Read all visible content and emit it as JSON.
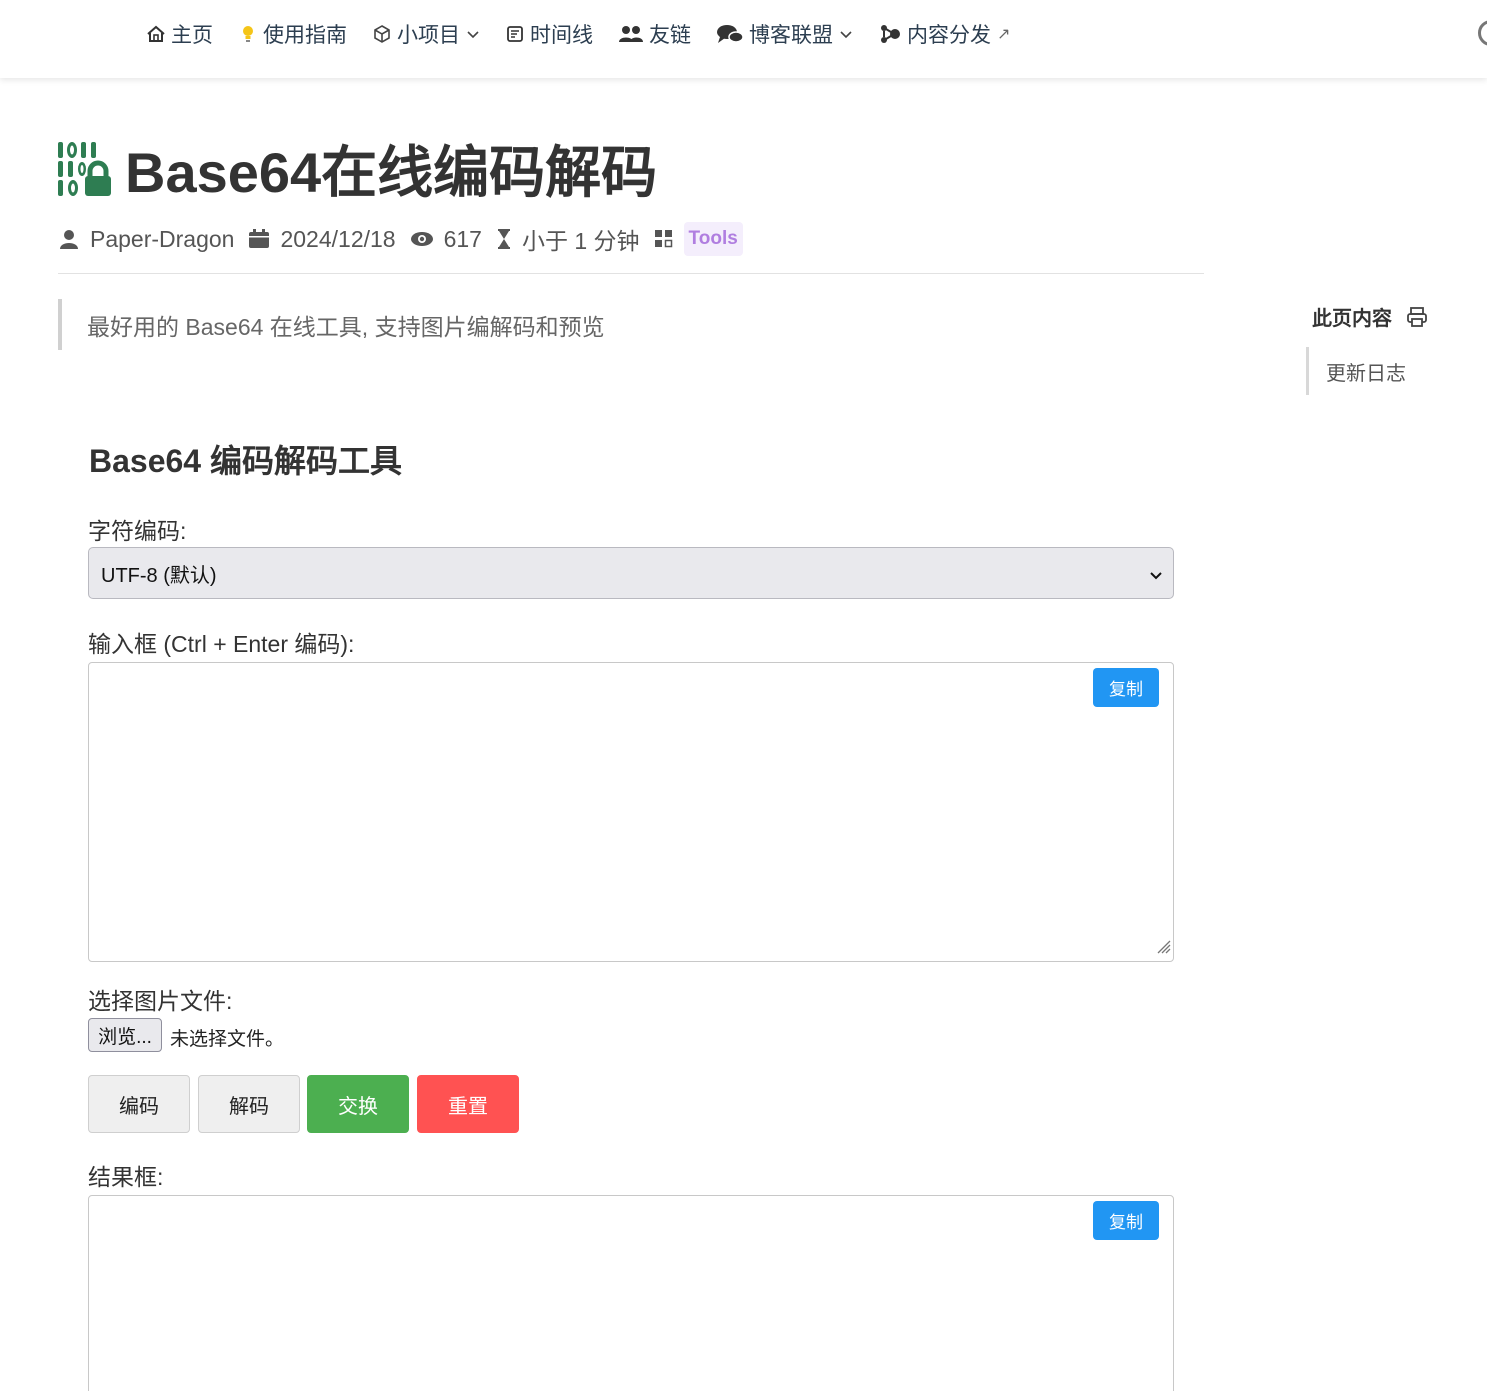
{
  "nav": {
    "items": [
      {
        "label": "主页",
        "icon": "home-icon"
      },
      {
        "label": "使用指南",
        "icon": "lightbulb-icon"
      },
      {
        "label": "小项目",
        "icon": "cube-icon",
        "dropdown": true
      },
      {
        "label": "时间线",
        "icon": "timeline-icon"
      },
      {
        "label": "友链",
        "icon": "users-icon"
      },
      {
        "label": "博客联盟",
        "icon": "chat-icon",
        "dropdown": true
      },
      {
        "label": "内容分发",
        "icon": "share-icon",
        "external": "↗"
      }
    ]
  },
  "page": {
    "title": "Base64在线编码解码",
    "title_icon": "binary-lock-icon",
    "title_icon_color": "#2e7d52"
  },
  "meta": {
    "author": "Paper-Dragon",
    "date": "2024/12/18",
    "views": "617",
    "read_time": "小于 1 分钟",
    "tag": "Tools"
  },
  "description": "最好用的 Base64 在线工具, 支持图片编解码和预览",
  "toc": {
    "heading": "此页内容",
    "items": [
      "更新日志"
    ]
  },
  "tool": {
    "title": "Base64 编码解码工具",
    "charset_label": "字符编码:",
    "charset_value": "UTF-8 (默认)",
    "input_label": "输入框 (Ctrl + Enter 编码):",
    "input_value": "",
    "copy_label": "复制",
    "file_label": "选择图片文件:",
    "file_button": "浏览...",
    "file_status": "未选择文件。",
    "buttons": {
      "encode": "编码",
      "decode": "解码",
      "swap": "交换",
      "reset": "重置"
    },
    "result_label": "结果框:",
    "result_value": "",
    "colors": {
      "copy": "#2196f3",
      "swap": "#4caf50",
      "reset": "#ff5252"
    }
  }
}
